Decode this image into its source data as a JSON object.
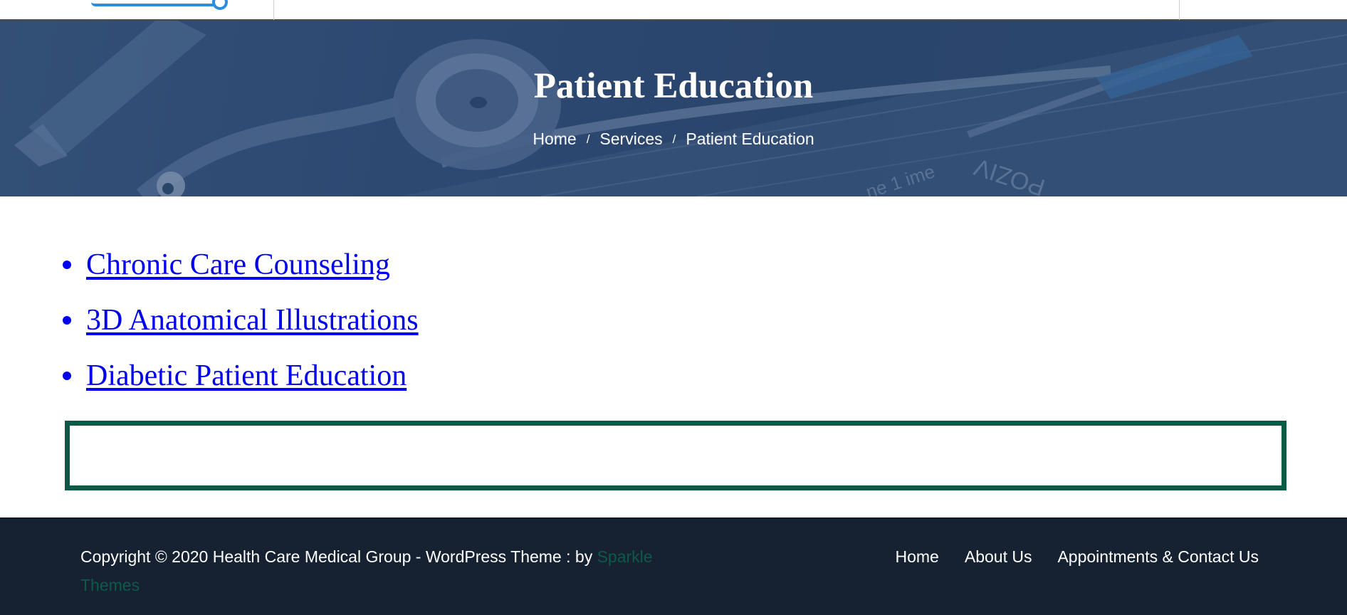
{
  "banner": {
    "title": "Patient Education",
    "breadcrumb": {
      "items": [
        "Home",
        "Services",
        "Patient Education"
      ],
      "separator": "/"
    }
  },
  "content": {
    "links": [
      "Chronic Care Counseling",
      "3D Anatomical Illustrations",
      "Diabetic Patient Education"
    ]
  },
  "footer": {
    "copyright_text": "Copyright © 2020 Health Care Medical Group - WordPress Theme : by ",
    "theme_brand": "Sparkle Themes",
    "nav": [
      "Home",
      "About Us",
      "Appointments & Contact Us"
    ]
  },
  "colors": {
    "banner_overlay": "#34507a",
    "link": "#0000ee",
    "box_border": "#0a5a46",
    "footer_bg": "#162232",
    "brand_link": "#0c5a47",
    "logo_accent": "#2b8fe0"
  },
  "icons": [
    "logo-mark-icon",
    "stethoscope-image"
  ]
}
